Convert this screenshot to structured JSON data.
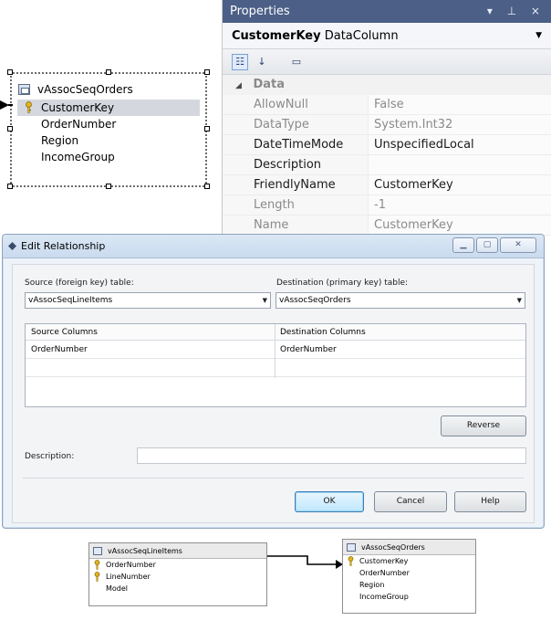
{
  "designer": {
    "table_title": "vAssocSeqOrders",
    "columns": [
      "CustomerKey",
      "OrderNumber",
      "Region",
      "IncomeGroup"
    ],
    "selected_index": 0,
    "key_column_index": 0
  },
  "properties": {
    "window_title": "Properties",
    "title_buttons": "▾ ⊥ ×",
    "object_name": "CustomerKey",
    "object_type": "DataColumn",
    "category": "Data",
    "rows": [
      {
        "key": "AllowNull",
        "value": "False"
      },
      {
        "key": "DataType",
        "value": "System.Int32"
      },
      {
        "key": "DateTimeMode",
        "value": "UnspecifiedLocal"
      },
      {
        "key": "Description",
        "value": ""
      },
      {
        "key": "FriendlyName",
        "value": "CustomerKey"
      },
      {
        "key": "Length",
        "value": "-1"
      },
      {
        "key": "Name",
        "value": "CustomerKey"
      }
    ]
  },
  "dialog": {
    "title": "Edit Relationship",
    "source_label": "Source (foreign key) table:",
    "source_value": "vAssocSeqLineItems",
    "dest_label": "Destination (primary key) table:",
    "dest_value": "vAssocSeqOrders",
    "grid_headers": [
      "Source Columns",
      "Destination Columns"
    ],
    "grid_row": [
      "OrderNumber",
      "OrderNumber"
    ],
    "reverse_label": "Reverse",
    "description_label": "Description:",
    "description_value": "",
    "ok_label": "OK",
    "cancel_label": "Cancel",
    "help_label": "Help"
  },
  "diagram": {
    "left_table": {
      "title": "vAssocSeqLineItems",
      "columns": [
        "OrderNumber",
        "LineNumber",
        "Model"
      ],
      "key_columns": [
        0,
        1
      ]
    },
    "right_table": {
      "title": "vAssocSeqOrders",
      "columns": [
        "CustomerKey",
        "OrderNumber",
        "Region",
        "IncomeGroup"
      ],
      "key_columns": [
        0
      ]
    }
  }
}
